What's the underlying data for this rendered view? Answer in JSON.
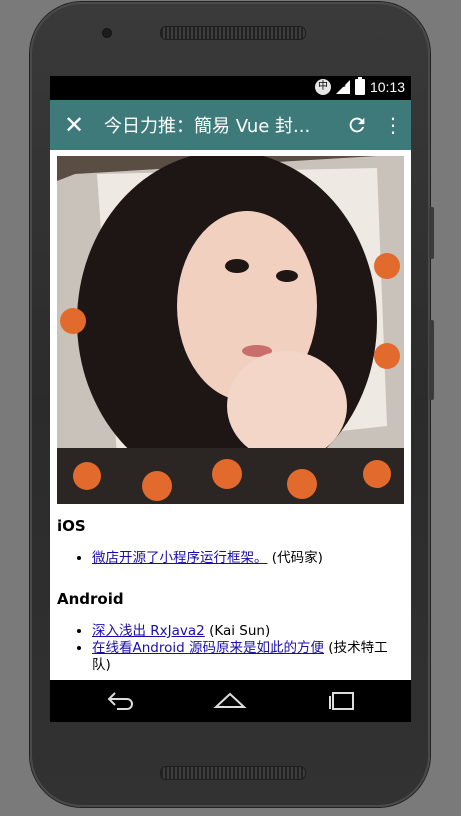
{
  "status_bar": {
    "ime": "中",
    "network": "4G",
    "time": "10:13"
  },
  "toolbar": {
    "title": "今日力推：簡易 Vue 封...",
    "close_icon": "close-icon",
    "refresh_icon": "refresh-icon",
    "more_icon": "more-vert-icon"
  },
  "hero_image": {
    "description_icon": "photo"
  },
  "sections": [
    {
      "heading": "iOS",
      "items": [
        {
          "link": "微店开源了小程序运行框架。",
          "source": "(代码家)"
        }
      ]
    },
    {
      "heading": "Android",
      "items": [
        {
          "link": "深入浅出 RxJava2",
          "source": "(Kai Sun)"
        },
        {
          "link": "在线看Android 源码原来是如此的方便",
          "source": "(技术特工队)"
        }
      ]
    }
  ],
  "navigation": {
    "back_icon": "back-icon",
    "home_icon": "home-icon",
    "recents_icon": "recents-icon"
  },
  "colors": {
    "toolbar": "#3f7a7a",
    "link": "#1a0dab",
    "status_bar": "#000000"
  }
}
